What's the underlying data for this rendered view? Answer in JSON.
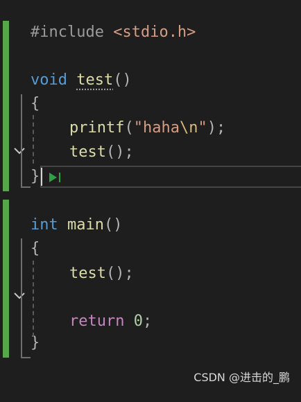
{
  "colors": {
    "background": "#1e1e1e",
    "changed_line_marker": "#57a64a",
    "keyword": "#569cd6",
    "control_keyword": "#c586c0",
    "function": "#dcdcaa",
    "string": "#d69d85",
    "escape": "#d7ba7d",
    "number": "#b5cea8",
    "preprocessor": "#9b9b9b",
    "punctuation": "#b4b4b4"
  },
  "code": {
    "line1": {
      "directive": "#include",
      "header": "<stdio.h>"
    },
    "line3": {
      "type": "void",
      "name": "test",
      "parens": "()"
    },
    "line4": {
      "brace": "{"
    },
    "line5": {
      "fn": "printf",
      "open": "(",
      "str_open": "\"haha",
      "escape": "\\n",
      "str_close": "\"",
      "close": ");"
    },
    "line6": {
      "fn": "test",
      "rest": "();"
    },
    "line7": {
      "brace": "}"
    },
    "line9": {
      "type": "int",
      "name": "main",
      "parens": "()"
    },
    "line10": {
      "brace": "{"
    },
    "line11": {
      "fn": "test",
      "rest": "();"
    },
    "line13": {
      "keyword": "return",
      "value": "0",
      "semi": ";"
    },
    "line14": {
      "brace": "}"
    }
  },
  "icons": {
    "fold": "chevron-down-icon",
    "run_to_cursor": "run-to-click-icon"
  },
  "watermark": "CSDN @进击的_鹏"
}
